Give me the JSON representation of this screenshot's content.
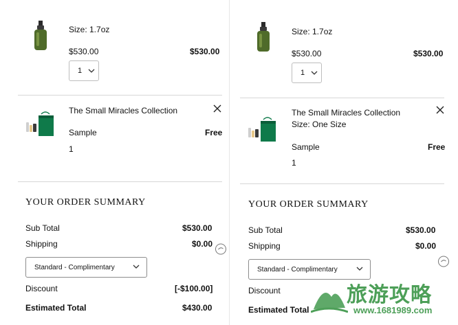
{
  "left": {
    "product": {
      "size": "Size: 1.7oz",
      "unit_price": "$530.00",
      "line_total": "$530.00",
      "qty": "1"
    },
    "sample": {
      "name": "The Small Miracles Collection",
      "type": "Sample",
      "price": "Free",
      "qty": "1"
    },
    "summary": {
      "title": "YOUR ORDER SUMMARY",
      "subtotal_label": "Sub Total",
      "subtotal_value": "$530.00",
      "shipping_label": "Shipping",
      "shipping_value": "$0.00",
      "shipping_option": "Standard - Complimentary",
      "discount_label": "Discount",
      "discount_value": "[-$100.00]",
      "total_label": "Estimated Total",
      "total_value": "$430.00"
    }
  },
  "right": {
    "product": {
      "size": "Size: 1.7oz",
      "unit_price": "$530.00",
      "line_total": "$530.00",
      "qty": "1"
    },
    "sample": {
      "name": "The Small Miracles Collection",
      "size": "Size: One Size",
      "type": "Sample",
      "price": "Free",
      "qty": "1"
    },
    "summary": {
      "title": "YOUR ORDER SUMMARY",
      "subtotal_label": "Sub Total",
      "subtotal_value": "$530.00",
      "shipping_label": "Shipping",
      "shipping_value": "$0.00",
      "shipping_option": "Standard - Complimentary",
      "discount_label": "Discount",
      "total_label": "Estimated Total"
    }
  },
  "watermark": {
    "title": "旅游攻略",
    "url": "www.1681989.com"
  },
  "colors": {
    "bottle": "#4f6b2a",
    "bag": "#0f7a4a",
    "watermark": "#2f8f3c"
  }
}
